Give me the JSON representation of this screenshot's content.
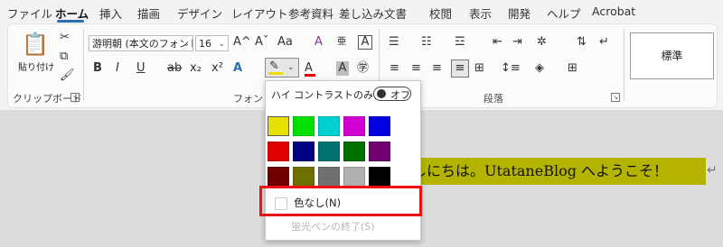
{
  "tabs": [
    "ファイル",
    "ホーム",
    "挿入",
    "描画",
    "デザイン",
    "レイアウト",
    "参考資料",
    "差し込み文書",
    "校閲",
    "表示",
    "開発",
    "ヘルプ",
    "Acrobat"
  ],
  "clipboard": {
    "paste_label": "貼り付け",
    "group_label": "クリップボード"
  },
  "font": {
    "name": "游明朝 (本文のフォント",
    "size": "16",
    "group_label": "フォント",
    "bold": "B",
    "italic": "I",
    "underline": "U",
    "strike": "ab",
    "subscript": "x₂",
    "superscript": "x²",
    "grow": "A^",
    "shrink": "Aˇ",
    "case": "Aa",
    "clear": "A",
    "phonetic": "亜",
    "border": "A"
  },
  "paragraph": {
    "group_label": "段落"
  },
  "styles": {
    "normal": "標準"
  },
  "highlight_menu": {
    "high_contrast_label": "ハイ コントラストのみ(H)",
    "toggle_state": "オフ",
    "colors": [
      "#e8e000",
      "#00e000",
      "#00d0d0",
      "#d000d0",
      "#0000e0",
      "#e00000",
      "#000080",
      "#007070",
      "#007000",
      "#700070",
      "#700000",
      "#707000",
      "#707070",
      "#b0b0b0",
      "#000000"
    ],
    "no_color_label": "色なし(N)",
    "end_label": "蛍光ペンの終了(S)"
  },
  "document": {
    "text": "しにちは。UtataneBlog へようこそ！"
  },
  "accent": "#2b6cb0",
  "highlight_color": "#b4b400"
}
